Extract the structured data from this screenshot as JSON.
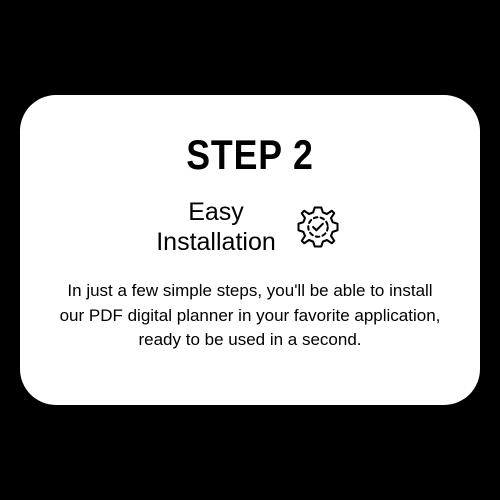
{
  "card": {
    "step_label": "STEP 2",
    "subtitle_line1": "Easy",
    "subtitle_line2": "Installation",
    "description": "In just a few simple steps, you'll be able to install our PDF digital planner in your favorite application, ready to be used in a second."
  }
}
